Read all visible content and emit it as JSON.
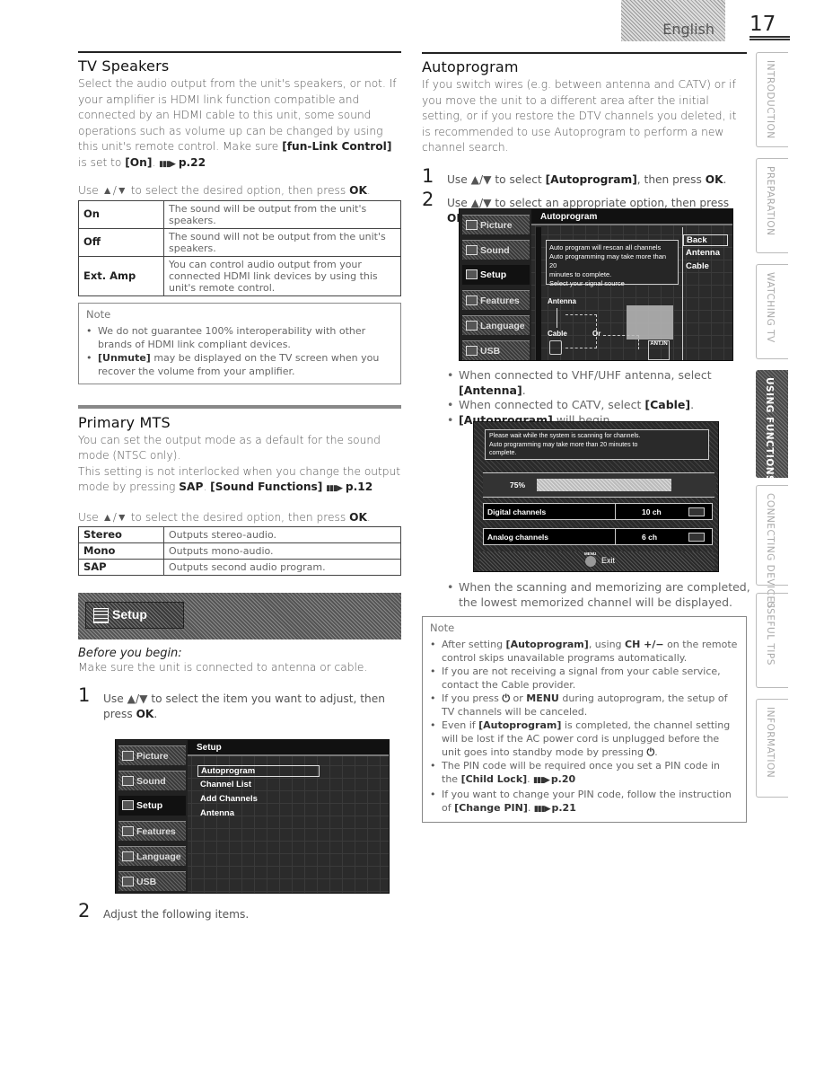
{
  "header": {
    "language": "English",
    "page_number": "17"
  },
  "side_tabs": [
    {
      "label": "INTRODUCTION",
      "active": false
    },
    {
      "label": "PREPARATION",
      "active": false
    },
    {
      "label": "WATCHING TV",
      "active": false
    },
    {
      "label": "USING FUNCTIONS",
      "active": true
    },
    {
      "label": "CONNECTING DEVICES",
      "active": false
    },
    {
      "label": "USEFUL TIPS",
      "active": false
    },
    {
      "label": "INFORMATION",
      "active": false
    }
  ],
  "tv_speakers": {
    "title": "TV Speakers",
    "p1": "Select the audio output from the unit's speakers, or not. If your amplifier is HDMI link function compatible and connected by an HDMI cable to this unit, some sound operations such as volume up can be changed by using this unit's remote control.",
    "p2_pre": "Make sure ",
    "p2_kw1": "[fun-Link Control]",
    "p2_mid": " is set to ",
    "p2_kw2": "[On]",
    "p2_end": ".",
    "p2_ref": "p.22",
    "use_pre": "Use ▲/▼ to select the desired option, then press ",
    "use_ok": "OK",
    "use_end": ".",
    "options": [
      {
        "key": "On",
        "desc": "The sound will be output from the unit's speakers."
      },
      {
        "key": "Off",
        "desc": "The sound will not be output from the unit's speakers."
      },
      {
        "key": "Ext. Amp",
        "desc": "You can control audio output from your connected HDMI link devices by using this unit's remote control."
      }
    ],
    "note_title": "Note",
    "notes": [
      {
        "kw": "",
        "text": "We do not guarantee 100% interoperability with other brands of HDMI link compliant devices."
      },
      {
        "kw": "[Unmute]",
        "text": " may be displayed on the TV screen when you recover the volume from your amplifier."
      }
    ]
  },
  "primary_mts": {
    "title": "Primary MTS",
    "p1": "You can set the output mode as a default for the sound mode (NTSC only).",
    "p2": "This setting is not interlocked when you change the output mode by pressing ",
    "p2_kw1": "SAP",
    "p2_sep": ". ",
    "p2_kw2": "[Sound Functions]",
    "p2_ref": "p.12",
    "use_pre": "Use ▲/▼ to select the desired option, then press ",
    "use_ok": "OK",
    "use_end": ".",
    "options": [
      {
        "key": "Stereo",
        "desc": "Outputs stereo-audio."
      },
      {
        "key": "Mono",
        "desc": "Outputs mono-audio."
      },
      {
        "key": "SAP",
        "desc": "Outputs second audio program."
      }
    ]
  },
  "setup_section": {
    "banner_label": "Setup",
    "before_title": "Before you begin:",
    "before_text": "Make sure the unit is connected to antenna or cable.",
    "step1_num": "1",
    "step1_text": "Use ▲/▼ to select the item you want to adjust, then press ",
    "step1_ok": "OK",
    "step1_end": ".",
    "step2_num": "2",
    "step2_text": "Adjust the following items."
  },
  "tv_menu": {
    "sidebar": [
      "Picture",
      "Sound",
      "Setup",
      "Features",
      "Language",
      "USB"
    ],
    "selected_sidebar": "Setup",
    "title": "Setup",
    "items": [
      "Autoprogram",
      "Channel List",
      "Add Channels",
      "Antenna"
    ],
    "selected_item": "Autoprogram"
  },
  "autoprogram": {
    "title": "Autoprogram",
    "p1": "If you switch wires (e.g. between antenna and CATV) or if you move the unit to a different area after the initial setting, or if you restore the DTV channels you deleted, it is recommended to use Autoprogram to perform a new channel search.",
    "step1_num": "1",
    "step1_pre": "Use ▲/▼ to select ",
    "step1_kw": "[Autoprogram]",
    "step1_mid": ", then press ",
    "step1_ok": "OK",
    "step1_end": ".",
    "step2_num": "2",
    "step2_pre": "Use ▲/▼ to select an appropriate option, then press ",
    "step2_ok": "OK",
    "step2_end": ".",
    "bullets": [
      {
        "pre": "When connected to VHF/UHF antenna, select ",
        "kw": "[Antenna]",
        "post": "."
      },
      {
        "pre": "When connected to CATV, select ",
        "kw": "[Cable]",
        "post": "."
      },
      {
        "pre": "",
        "kw": "[Autoprogram]",
        "post": " will begin."
      }
    ],
    "final_bullet": "When the scanning and memorizing are completed, the lowest memorized channel will be displayed.",
    "note_title": "Note",
    "notes": [
      {
        "segs": [
          {
            "t": "After setting "
          },
          {
            "b": "[Autoprogram]"
          },
          {
            "t": ", using "
          },
          {
            "b": "CH +/−"
          },
          {
            "t": " on the remote control skips unavailable programs automatically."
          }
        ]
      },
      {
        "segs": [
          {
            "t": "If you are not receiving a signal from your cable service, contact the Cable provider."
          }
        ]
      },
      {
        "segs": [
          {
            "t": "If you press "
          },
          {
            "b": "⏻"
          },
          {
            "t": " or "
          },
          {
            "b": "MENU"
          },
          {
            "t": " during autoprogram, the setup of TV channels will be canceled."
          }
        ]
      },
      {
        "segs": [
          {
            "t": "Even if "
          },
          {
            "b": "[Autoprogram]"
          },
          {
            "t": " is completed, the channel setting will be lost if the AC power cord is unplugged before the unit goes into standby mode by pressing "
          },
          {
            "b": "⏻"
          },
          {
            "t": "."
          }
        ]
      },
      {
        "segs": [
          {
            "t": "The PIN code will be required once you set a PIN code in the "
          },
          {
            "b": "[Child Lock]"
          },
          {
            "t": ". "
          },
          {
            "r": "p.20"
          }
        ]
      },
      {
        "segs": [
          {
            "t": "If you want to change your PIN code, follow the instruction of "
          },
          {
            "b": "[Change PIN]"
          },
          {
            "t": ". "
          },
          {
            "r": "p.21"
          }
        ]
      }
    ]
  },
  "tv_autoprogram": {
    "sidebar": [
      "Picture",
      "Sound",
      "Setup",
      "Features",
      "Language",
      "USB"
    ],
    "title": "Autoprogram",
    "message": [
      "Auto program will rescan all channels",
      "Auto programming may take more than 20",
      "minutes to complete.",
      "Select your signal source"
    ],
    "options": [
      "Back",
      "Antenna",
      "Cable"
    ],
    "selected_option": "Back",
    "diagram": {
      "antenna": "Antenna",
      "cable": "Cable",
      "or": "Or",
      "ant_in": "ANT.IN"
    }
  },
  "tv_scan": {
    "message": [
      "Please wait while the system is scanning for channels.",
      "Auto programming may take more than 20 minutes to",
      "complete."
    ],
    "progress_label": "75%",
    "progress": 0.75,
    "rows": [
      {
        "label": "Digital channels",
        "value": "10 ch"
      },
      {
        "label": "Analog channels",
        "value": "6 ch"
      }
    ],
    "menu_label": "MENU",
    "exit_label": "Exit"
  }
}
